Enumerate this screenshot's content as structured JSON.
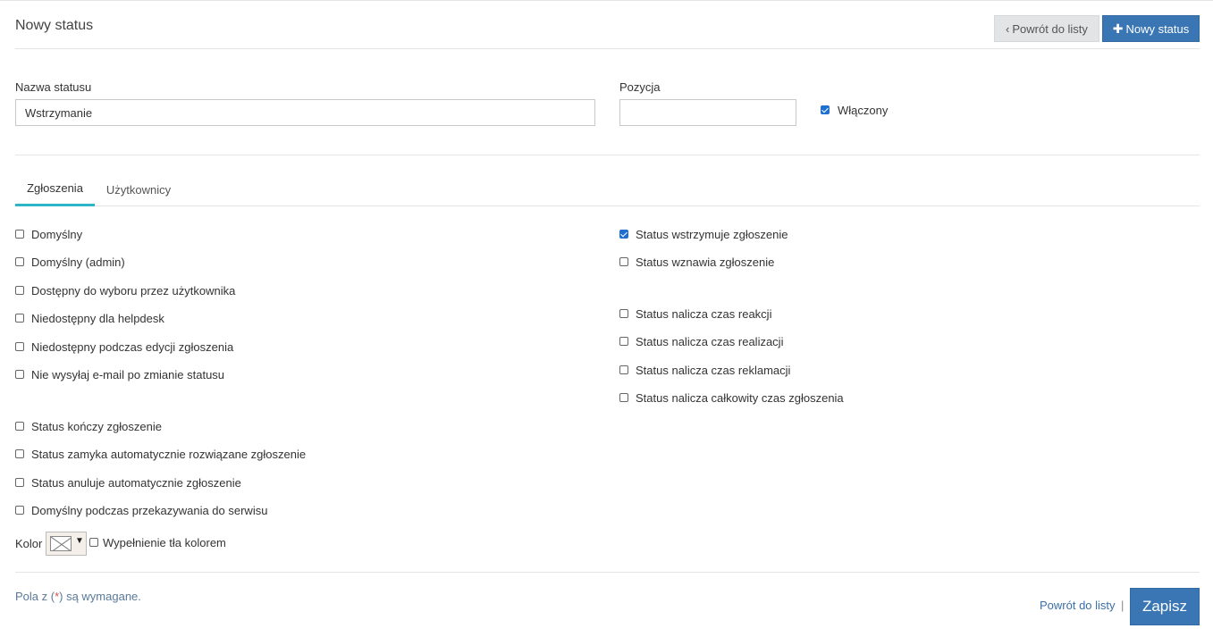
{
  "header": {
    "title": "Nowy status",
    "back_label": "Powrót do listy",
    "new_label": "Nowy status"
  },
  "form": {
    "name_label": "Nazwa statusu",
    "name_value": "Wstrzymanie",
    "position_label": "Pozycja",
    "position_value": "",
    "enabled_label": "Włączony",
    "enabled_checked": true
  },
  "tabs": [
    {
      "label": "Zgłoszenia",
      "active": true
    },
    {
      "label": "Użytkownicy",
      "active": false
    }
  ],
  "left_options": [
    {
      "label": "Domyślny",
      "checked": false
    },
    {
      "label": "Domyślny (admin)",
      "checked": false
    },
    {
      "label": "Dostępny do wyboru przez użytkownika",
      "checked": false
    },
    {
      "label": "Niedostępny dla helpdesk",
      "checked": false
    },
    {
      "label": "Niedostępny podczas edycji zgłoszenia",
      "checked": false
    },
    {
      "label": "Nie wysyłaj e-mail po zmianie statusu",
      "checked": false
    },
    {
      "label": "Status kończy zgłoszenie",
      "checked": false
    },
    {
      "label": "Status zamyka automatycznie rozwiązane zgłoszenie",
      "checked": false
    },
    {
      "label": "Status anuluje automatycznie zgłoszenie",
      "checked": false
    },
    {
      "label": "Domyślny podczas przekazywania do serwisu",
      "checked": false
    }
  ],
  "right_options": [
    {
      "label": "Status wstrzymuje zgłoszenie",
      "checked": true
    },
    {
      "label": "Status wznawia zgłoszenie",
      "checked": false
    },
    {
      "label": "Status nalicza czas reakcji",
      "checked": false
    },
    {
      "label": "Status nalicza czas realizacji",
      "checked": false
    },
    {
      "label": "Status nalicza czas reklamacji",
      "checked": false
    },
    {
      "label": "Status nalicza całkowity czas zgłoszenia",
      "checked": false
    }
  ],
  "color": {
    "label": "Kolor",
    "fill_label": "Wypełnienie tła kolorem",
    "fill_checked": false,
    "arrow": "▼"
  },
  "footer": {
    "note_prefix": "Pola z (",
    "note_star": "*",
    "note_suffix": ") są wymagane.",
    "back_label": "Powrót do listy",
    "pipe": "|",
    "save_label": "Zapisz"
  },
  "colors": {
    "primary": "#3a76b4",
    "tab_accent": "#2bb5c6",
    "checkbox": "#1f6fd0"
  }
}
